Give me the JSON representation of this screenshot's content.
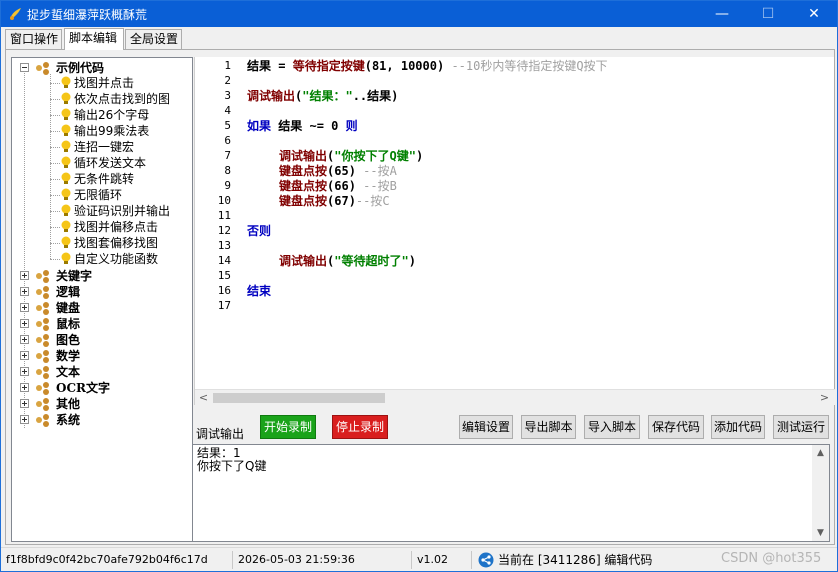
{
  "window": {
    "title": "捉步蜇细瀑萍跃概酥荒",
    "controls": {
      "minimize": "—",
      "maximize": "☐",
      "close": "✕"
    }
  },
  "tabs": [
    {
      "label": "窗口操作"
    },
    {
      "label": "脚本编辑"
    },
    {
      "label": "全局设置"
    }
  ],
  "tree": {
    "root": {
      "label": "示例代码",
      "children": [
        "找图并点击",
        "依次点击找到的图",
        "输出26个字母",
        "输出99乘法表",
        "连招一键宏",
        "循环发送文本",
        "无条件跳转",
        "无限循环",
        "验证码识别并输出",
        "找图并偏移点击",
        "找图套偏移找图",
        "自定义功能函数"
      ]
    },
    "categories": [
      "关键字",
      "逻辑",
      "键盘",
      "鼠标",
      "图色",
      "数学",
      "文本",
      "OCR文字",
      "其他",
      "系统"
    ]
  },
  "editor": {
    "line_numbers": [
      "1",
      "2",
      "3",
      "4",
      "5",
      "6",
      "7",
      "8",
      "9",
      "10",
      "11",
      "12",
      "13",
      "14",
      "15",
      "16",
      "17"
    ],
    "lines": {
      "l1": {
        "var": "结果",
        "op": " = ",
        "fn": "等待指定按键",
        "args": "(81, 10000)",
        "comment": "--10秒内等待指定按键Q按下"
      },
      "l3": {
        "fn": "调试输出",
        "open": "(",
        "str": "\"结果：\"",
        "rest": "..结果)"
      },
      "l5": {
        "kw": "如果",
        "cond": " 结果 ~= 0 ",
        "kw2": "则"
      },
      "l7": {
        "fn": "调试输出",
        "open": "(",
        "str": "\"你按下了Q键\"",
        "close": ")"
      },
      "l8": {
        "fn": "键盘点按",
        "args": "(65)",
        "comment": "--按A"
      },
      "l9": {
        "fn": "键盘点按",
        "args": "(66)",
        "comment": "--按B"
      },
      "l10": {
        "fn": "键盘点按",
        "args": "(67)",
        "comment": "--按C"
      },
      "l12": {
        "kw": "否则"
      },
      "l14": {
        "fn": "调试输出",
        "open": "(",
        "str": "\"等待超时了\"",
        "close": ")"
      },
      "l16": {
        "kw": "结束"
      }
    },
    "scroll_left": "<",
    "scroll_right": ">"
  },
  "output": {
    "label": "调试输出",
    "lines": [
      "结果：1",
      "你按下了Q键"
    ]
  },
  "buttons": {
    "start_record": "开始录制",
    "stop_record": "停止录制",
    "edit_settings": "编辑设置",
    "export_script": "导出脚本",
    "import_script": "导入脚本",
    "save_code": "保存代码",
    "add_code": "添加代码",
    "test_run": "测试运行"
  },
  "status": {
    "hash": "f1f8bfd9c0f42bc70afe792b04f6c17d",
    "datetime": "2026-05-03 21:59:36",
    "version": "v1.02",
    "current": "当前在 [3411286] 编辑代码",
    "watermark": "CSDN @hot355"
  },
  "colors": {
    "titlebar": "#0a5fd6",
    "function": "#800000",
    "keyword": "#0000c0",
    "string": "#008000",
    "comment": "#a0a0a0",
    "record_start": "#1aa31a",
    "record_stop": "#d91e1e"
  }
}
